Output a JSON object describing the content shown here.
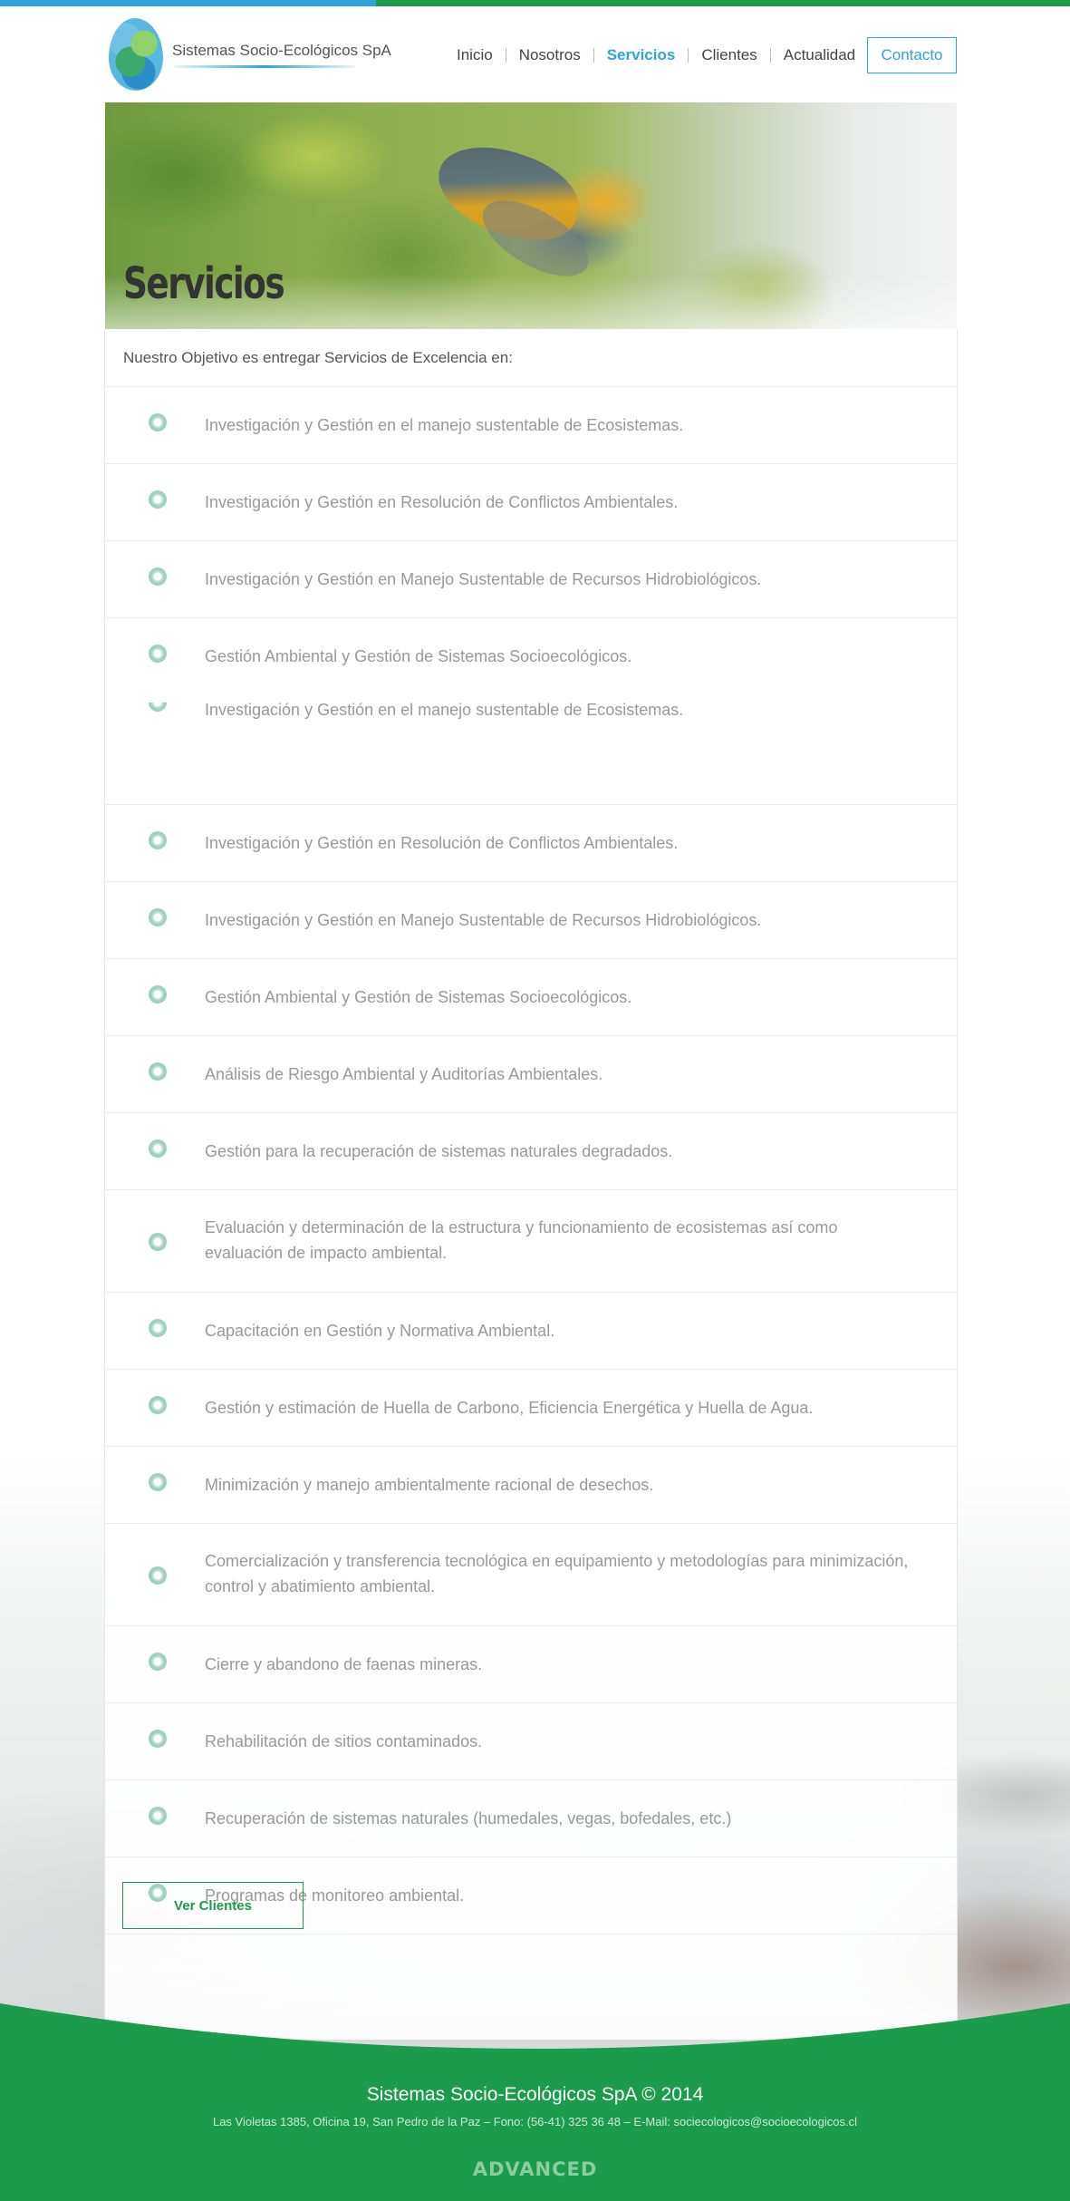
{
  "brand": {
    "name": "Sistemas Socio-Ecológicos SpA",
    "logo_icon": "fingerprint-globe-logo"
  },
  "colors": {
    "accent_blue": "#2ea3de",
    "brand_green": "#1a9c4a",
    "text_gray": "#999999"
  },
  "nav": {
    "items": [
      {
        "label": "Inicio",
        "active": false
      },
      {
        "label": "Nosotros",
        "active": false
      },
      {
        "label": "Servicios",
        "active": true
      },
      {
        "label": "Clientes",
        "active": false
      },
      {
        "label": "Actualidad",
        "active": false
      }
    ],
    "contact_label": "Contacto"
  },
  "hero": {
    "title": "Servicios"
  },
  "intro": "Nuestro Objetivo es entregar Servicios de  Excelencia en:",
  "services": [
    "Investigación y Gestión en el manejo sustentable de Ecosistemas.",
    "Investigación y Gestión en Resolución de Conflictos Ambientales.",
    "Investigación y Gestión en Manejo Sustentable de Recursos Hidrobiológicos.",
    "Gestión Ambiental y Gestión de Sistemas Socioecológicos.",
    "Investigación y Gestión en el manejo sustentable de Ecosistemas.",
    "Investigación y Gestión en Resolución de Conflictos Ambientales.",
    "Investigación y Gestión en Manejo Sustentable de Recursos Hidrobiológicos.",
    "Gestión Ambiental y Gestión de Sistemas Socioecológicos.",
    "Análisis de Riesgo Ambiental y Auditorías Ambientales.",
    "Gestión para la recuperación de sistemas naturales degradados.",
    "Evaluación y determinación de la estructura y funcionamiento de ecosistemas así como evaluación de impacto ambiental.",
    "Capacitación en Gestión y Normativa Ambiental.",
    "Gestión y estimación de Huella de Carbono, Eficiencia Energética y Huella de Agua.",
    "Minimización y manejo ambientalmente racional de desechos.",
    "Comercialización y transferencia tecnológica en equipamiento y metodologías para minimización, control y abatimiento ambiental.",
    "Cierre y abandono de faenas mineras.",
    "Rehabilitación de sitios contaminados.",
    "Recuperación de sistemas naturales (humedales, vegas, bofedales, etc.)",
    "Programas de monitoreo ambiental."
  ],
  "cta": {
    "label": "Ver Clientes"
  },
  "footer": {
    "title": "Sistemas Socio-Ecológicos SpA  © 2014",
    "address": "Las Violetas 1385, Oficina 19, San Pedro de la Paz – Fono: (56-41) 325 36 48 – E-Mail: sociecologicos@socioecologicos.cl",
    "credit": "ADVANCED"
  }
}
